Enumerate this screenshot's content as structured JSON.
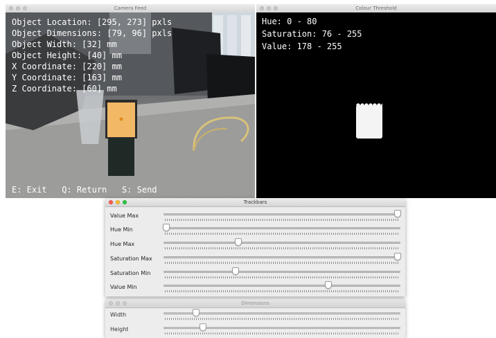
{
  "camera_window": {
    "title": "Camera Feed",
    "overlay_lines": [
      "Object Location: [295, 273] pxls",
      "Object Dimensions: [79, 96] pxls",
      "Object Width: [32] mm",
      "Object Height: [40] mm",
      "X Coordinate: [220] mm",
      "Y Coordinate: [163] mm",
      "Z Coordinate: [60] mm"
    ],
    "footer": "E: Exit   Q: Return   S: Send"
  },
  "threshold_window": {
    "title": "Colour Threshold",
    "lines": [
      "Hue: 0 - 80",
      "Saturation: 76 - 255",
      "Value: 178 - 255"
    ]
  },
  "trackbars_window": {
    "title": "Trackbars",
    "sliders": [
      {
        "label": "Value Max",
        "fraction": 1.0
      },
      {
        "label": "Hue Min",
        "fraction": 0.0
      },
      {
        "label": "Hue Max",
        "fraction": 0.31
      },
      {
        "label": "Saturation Max",
        "fraction": 1.0
      },
      {
        "label": "Saturation Min",
        "fraction": 0.3
      },
      {
        "label": "Value Min",
        "fraction": 0.7
      }
    ]
  },
  "dimensions_window": {
    "title": "Dimensions",
    "sliders": [
      {
        "label": "Width",
        "fraction": 0.13
      },
      {
        "label": "Height",
        "fraction": 0.16
      }
    ]
  }
}
